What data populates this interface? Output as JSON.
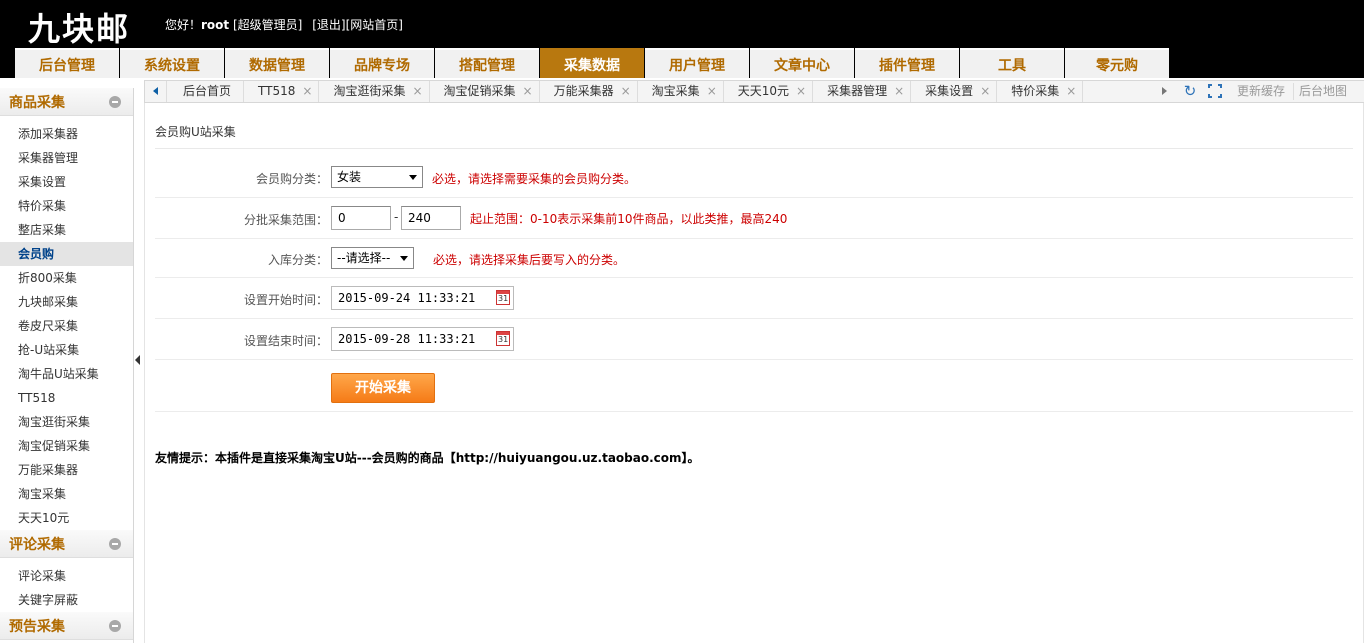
{
  "brand": {
    "logo": "九块邮"
  },
  "user": {
    "greeting": "您好！",
    "name": "root",
    "role": "[超级管理员]",
    "logout": "[退出]",
    "home_link": "[网站首页]"
  },
  "main_nav": [
    {
      "label": "后台管理",
      "active": false
    },
    {
      "label": "系统设置",
      "active": false
    },
    {
      "label": "数据管理",
      "active": false
    },
    {
      "label": "品牌专场",
      "active": false
    },
    {
      "label": "搭配管理",
      "active": false
    },
    {
      "label": "采集数据",
      "active": true
    },
    {
      "label": "用户管理",
      "active": false
    },
    {
      "label": "文章中心",
      "active": false
    },
    {
      "label": "插件管理",
      "active": false
    },
    {
      "label": "工具",
      "active": false
    },
    {
      "label": "零元购",
      "active": false
    }
  ],
  "sidebar": {
    "groups": [
      {
        "title": "商品采集",
        "items": [
          "添加采集器",
          "采集器管理",
          "采集设置",
          "特价采集",
          "整店采集",
          "会员购",
          "折800采集",
          "九块邮采集",
          "卷皮尺采集",
          "抢-U站采集",
          "淘牛品U站采集",
          "TT518",
          "淘宝逛街采集",
          "淘宝促销采集",
          "万能采集器",
          "淘宝采集",
          "天天10元"
        ],
        "active": "会员购"
      },
      {
        "title": "评论采集",
        "items": [
          "评论采集",
          "关键字屏蔽"
        ]
      },
      {
        "title": "预告采集",
        "items": []
      }
    ]
  },
  "tabs": {
    "home": "后台首页",
    "items": [
      "TT518",
      "淘宝逛街采集",
      "淘宝促销采集",
      "万能采集器",
      "淘宝采集",
      "天天10元",
      "采集器管理",
      "采集设置",
      "特价采集"
    ],
    "close": "×",
    "clear_cache": "更新缓存",
    "site_map": "后台地图"
  },
  "form": {
    "title": "会员购U站采集",
    "category_label": "会员购分类：",
    "category_value": "女装",
    "category_tip": "必选，请选择需要采集的会员购分类。",
    "range_label": "分批采集范围：",
    "range_from": "0",
    "range_dash": "-",
    "range_to": "240",
    "range_tip": "起止范围：0-10表示采集前10件商品，以此类推，最高240",
    "store_label": "入库分类：",
    "store_value": "--请选择--",
    "store_tip": "必选，请选择采集后要写入的分类。",
    "start_label": "设置开始时间：",
    "start_value": "2015-09-24 11:33:21",
    "end_label": "设置结束时间：",
    "end_value": "2015-09-28 11:33:21",
    "submit": "开始采集",
    "hint": "友情提示：本插件是直接采集淘宝U站---会员购的商品【http://huiyuangou.uz.taobao.com】。"
  }
}
